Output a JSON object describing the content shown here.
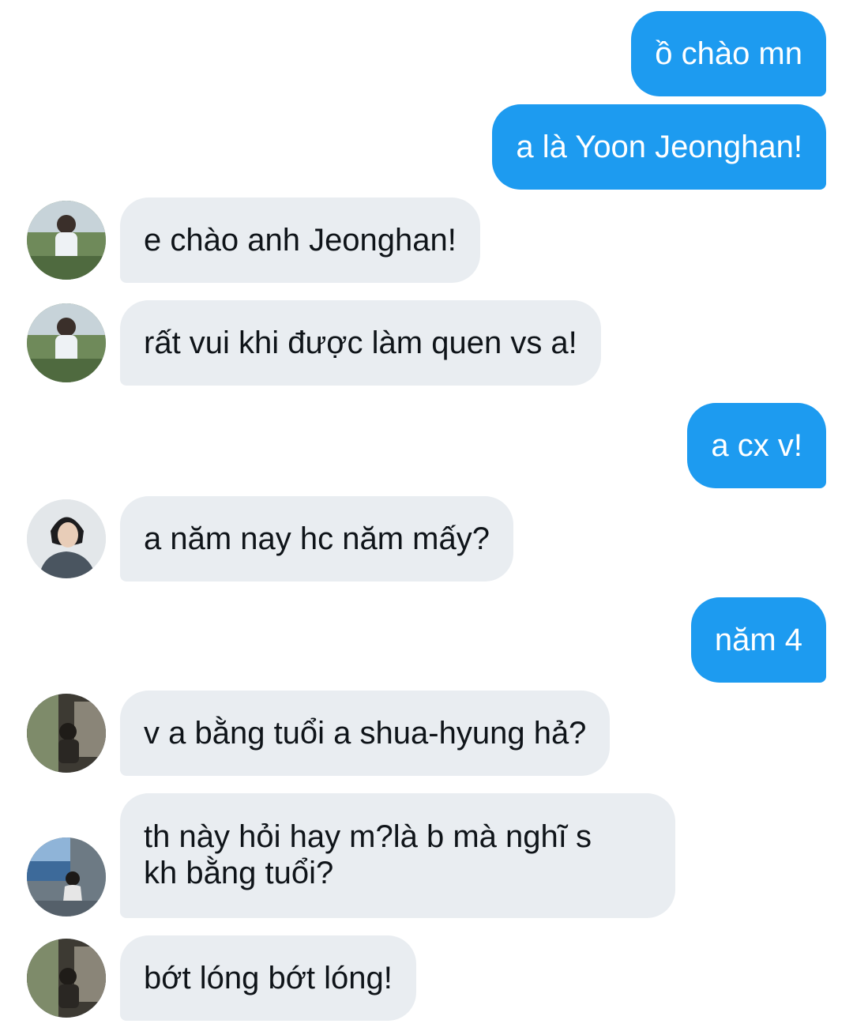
{
  "messages": [
    {
      "side": "out",
      "text": "ồ chào mn"
    },
    {
      "side": "out",
      "text": "a là Yoon Jeonghan!"
    },
    {
      "side": "in",
      "avatar": "outdoor-portrait-avatar",
      "text": "e chào anh Jeonghan!"
    },
    {
      "side": "in",
      "avatar": "outdoor-portrait-avatar",
      "text": "rất vui khi được làm quen vs a!"
    },
    {
      "side": "out",
      "text": "a cx v!"
    },
    {
      "side": "in",
      "avatar": "studio-portrait-avatar",
      "text": "a năm nay hc năm mấy?"
    },
    {
      "side": "out",
      "text": "năm 4"
    },
    {
      "side": "in",
      "avatar": "cafe-portrait-avatar",
      "text": "v a bằng tuổi a shua-hyung hả?"
    },
    {
      "side": "in",
      "avatar": "window-portrait-avatar",
      "text_line1": "th này hỏi hay m?là b mà nghĩ s",
      "text_line2": "kh bằng tuổi?"
    },
    {
      "side": "in",
      "avatar": "cafe-portrait-avatar",
      "text": "bớt lóng bớt lóng!"
    }
  ],
  "colors": {
    "outgoing_bubble": "#1d9bf0",
    "incoming_bubble": "#e9edf1",
    "incoming_text": "#0f1419",
    "outgoing_text": "#ffffff"
  }
}
